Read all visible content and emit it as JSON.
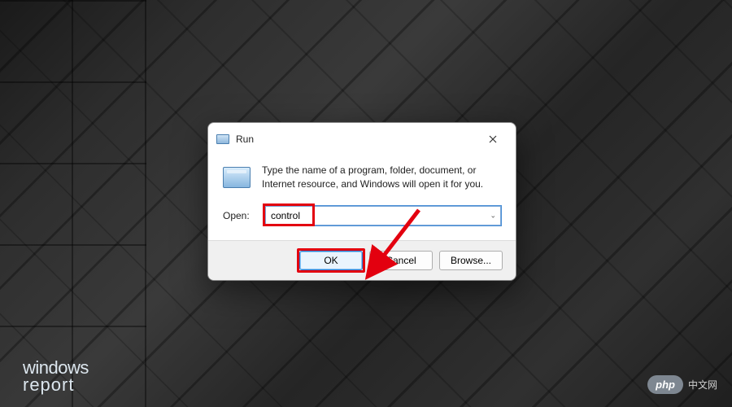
{
  "dialog": {
    "title": "Run",
    "description": "Type the name of a program, folder, document, or Internet resource, and Windows will open it for you.",
    "open_label": "Open:",
    "input_value": "control",
    "buttons": {
      "ok": "OK",
      "cancel": "Cancel",
      "browse": "Browse..."
    }
  },
  "watermarks": {
    "left_line1": "windows",
    "left_line2": "report",
    "right_badge": "php",
    "right_text": "中文网"
  },
  "annotation": {
    "highlight_input": true,
    "highlight_ok": true,
    "arrow_color": "#e3000f"
  }
}
